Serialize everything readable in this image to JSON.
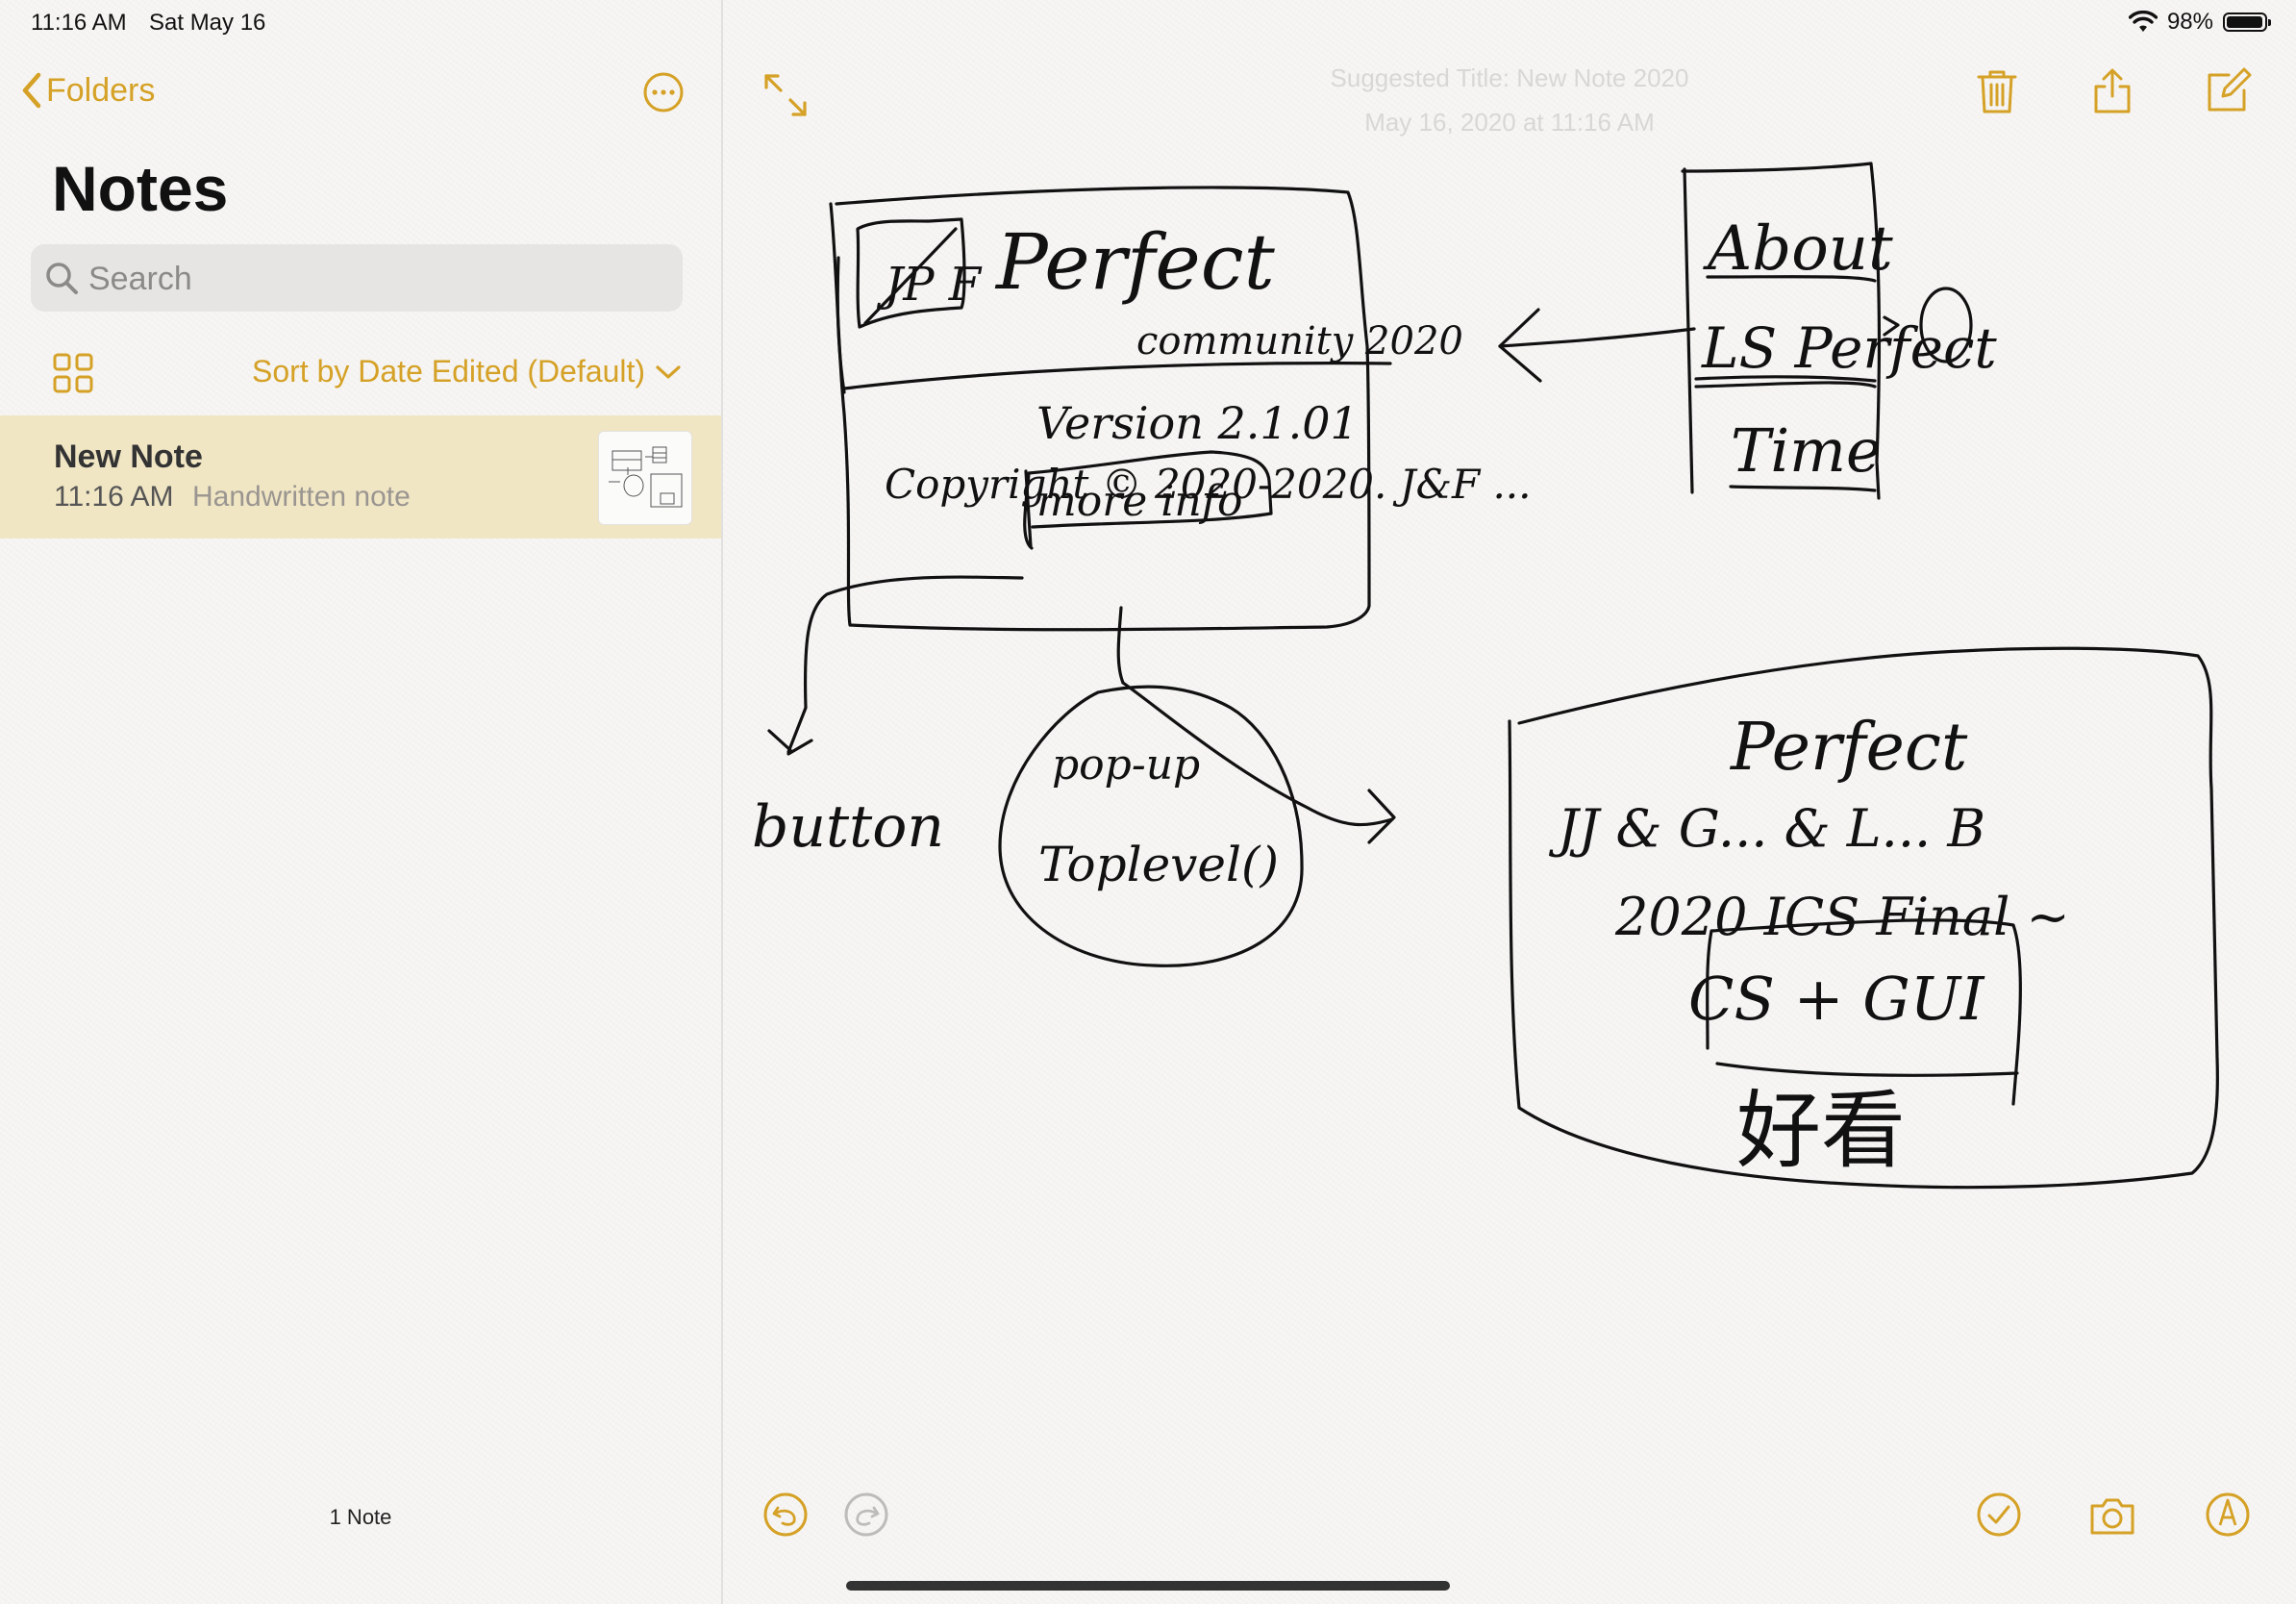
{
  "status_bar": {
    "time": "11:16 AM",
    "date": "Sat May 16",
    "battery_percent_label": "98%",
    "battery_level": 0.98
  },
  "sidebar": {
    "back_label": "Folders",
    "title": "Notes",
    "search_placeholder": "Search",
    "sort_label": "Sort by Date Edited (Default)",
    "notes": [
      {
        "title": "New Note",
        "time": "11:16 AM",
        "subtitle": "Handwritten note"
      }
    ],
    "count_label": "1 Note"
  },
  "note": {
    "ghost_title": "Suggested Title: New Note 2020",
    "ghost_date": "May 16, 2020 at 11:16 AM",
    "handwriting": {
      "box1_title": "Perfect",
      "box1_logo": "JP F",
      "box1_subtitle": "community 2020",
      "box1_version": "Version 2.1.01",
      "box1_copyright": "Copyright © 2020-2020. J&F ...",
      "box1_button": "more info",
      "label_button": "button",
      "circle_line1": "pop-up",
      "circle_line2": "Toplevel()",
      "menu_item1": "About",
      "menu_item2": "LS Perfect",
      "menu_item3": "Time",
      "box2_line1": "Perfect",
      "box2_line2": "JJ & G... & L... B",
      "box2_line3": "2020 ICS Final ~",
      "box2_line4": "CS + GUI",
      "box2_button": "好看"
    }
  },
  "colors": {
    "accent": "#d5a126",
    "selected_row": "#f0e6c4",
    "ink": "#111111"
  },
  "icons": {
    "back": "chevron-left-icon",
    "more": "ellipsis-circle-icon",
    "gallery": "grid-icon",
    "expand": "expand-arrows-icon",
    "trash": "trash-icon",
    "share": "share-icon",
    "compose": "compose-icon",
    "undo": "undo-icon",
    "redo": "redo-icon",
    "checklist": "checkmark-circle-icon",
    "camera": "camera-icon",
    "markup": "pen-circle-icon"
  }
}
